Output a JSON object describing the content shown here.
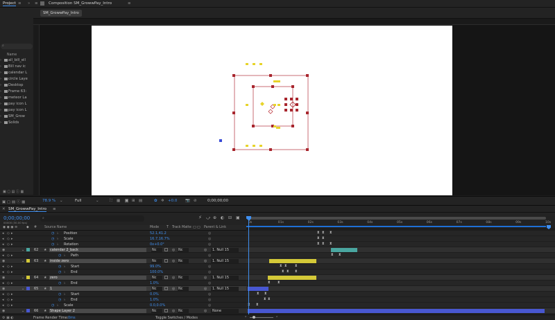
{
  "colors": {
    "accent": "#3f8ff0",
    "timecode": "#3f8ff0",
    "label_yellow": "#d4c938",
    "label_teal": "#4aa6a0",
    "label_blue": "#4857d1",
    "playhead": "#3f8ff0",
    "stage": "#ffffff",
    "handle": "#a8262e"
  },
  "topbar": {
    "project_tab": "Project",
    "comp_tab": "Composition SM_GrowwPay_Intro"
  },
  "comp": {
    "tab": "SM_GrowwPay_Intro"
  },
  "project": {
    "search_icon": "search-icon",
    "col_name": "Name",
    "items": [
      {
        "label": "all_bill_ell",
        "arrow": ""
      },
      {
        "label": "Bill nav ic",
        "arrow": ""
      },
      {
        "label": "calendar L",
        "arrow": ""
      },
      {
        "label": "circle Laye",
        "arrow": ""
      },
      {
        "label": "Desktop",
        "arrow": ""
      },
      {
        "label": "Frame 63:",
        "arrow": ""
      },
      {
        "label": "meteor La",
        "arrow": ""
      },
      {
        "label": "pay icon L",
        "arrow": ""
      },
      {
        "label": "pay icon L",
        "arrow": ""
      },
      {
        "label": "SM_Grow",
        "arrow": ""
      },
      {
        "label": "Solids",
        "arrow": ""
      }
    ]
  },
  "viewer": {
    "zoom": "78.9 %",
    "resolution": "Full",
    "exposure": "+0.0",
    "timecode": "0;00;00;00"
  },
  "timeline": {
    "tab": "SM_GrowwPay_Intro",
    "timecode": "0;00;00;00",
    "fps": "00000 (30.00 fps)",
    "search_placeholder": "",
    "cols": {
      "num": "#",
      "source": "Source Name",
      "mode": "Mode",
      "t": "T",
      "trkmat": "Track Matte",
      "parent": "Parent & Link"
    },
    "ruler": [
      "0s",
      "01s",
      "02s",
      "03s",
      "04s",
      "05s",
      "06s",
      "07s",
      "08s",
      "09s",
      "10s"
    ],
    "rows": [
      {
        "kind": "prop",
        "name": "Position",
        "value": "52.1,41.2",
        "indent": 2
      },
      {
        "kind": "prop",
        "name": "Scale",
        "value": "16.7,16.7%",
        "indent": 2
      },
      {
        "kind": "prop",
        "name": "Rotation",
        "value": "0x+0.0°",
        "indent": 2
      },
      {
        "kind": "layer",
        "num": "62",
        "name": "calendar 2_back",
        "mode": "Nc",
        "trk": "Nc",
        "parent": "1. Null 15",
        "label": "teal"
      },
      {
        "kind": "prop",
        "name": "Path",
        "value": "",
        "indent": 3
      },
      {
        "kind": "layer",
        "num": "63",
        "name": "inside zero",
        "mode": "Nc",
        "trk": "Nc",
        "parent": "1. Null 15",
        "label": "yellow"
      },
      {
        "kind": "prop",
        "name": "Start",
        "value": "99.0%",
        "indent": 3
      },
      {
        "kind": "prop",
        "name": "End",
        "value": "100.0%",
        "indent": 3
      },
      {
        "kind": "layer",
        "num": "64",
        "name": "zero",
        "mode": "Nc",
        "trk": "Nc",
        "parent": "1. Null 15",
        "label": "yellow"
      },
      {
        "kind": "prop",
        "name": "End",
        "value": "1.0%",
        "indent": 3
      },
      {
        "kind": "layer",
        "num": "65",
        "name": "1",
        "mode": "Nc",
        "trk": "Nc",
        "parent": "1. Null 15",
        "label": "blue",
        "selected": true
      },
      {
        "kind": "prop",
        "name": "Start",
        "value": "0.0%",
        "indent": 3
      },
      {
        "kind": "prop",
        "name": "End",
        "value": "1.0%",
        "indent": 3
      },
      {
        "kind": "prop",
        "name": "Scale",
        "value": "0.0,0.0%",
        "indent": 2
      },
      {
        "kind": "layer",
        "num": "66",
        "name": "Shape Layer 2",
        "mode": "Nc",
        "trk": "Nc",
        "parent": "None",
        "label": "blue"
      }
    ]
  },
  "status": {
    "render_time_label": "Frame Render Time:",
    "render_time": "0ms",
    "toggle": "Toggle Switches / Modes"
  }
}
